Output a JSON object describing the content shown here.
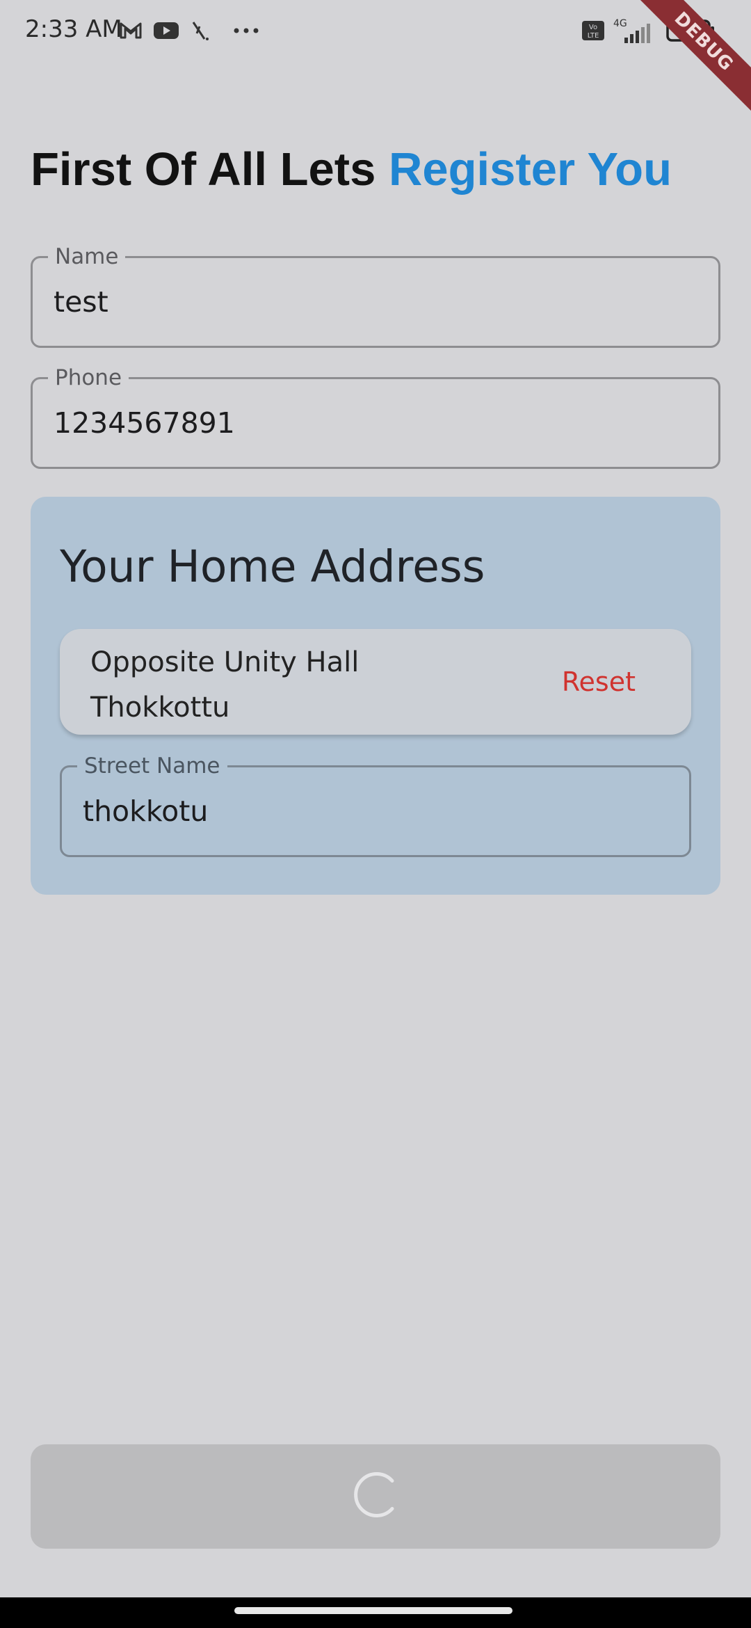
{
  "status_bar": {
    "time": "2:33 AM",
    "network": "4G",
    "volte": "Vo LTE",
    "icons": [
      "gmail-icon",
      "youtube-icon",
      "tool-icon",
      "more-dots-icon",
      "volte-icon",
      "signal-icon",
      "battery-icon"
    ]
  },
  "debug_banner": "DEBUG",
  "title": {
    "prefix": "First Of All Lets ",
    "accent": "Register You",
    "accent_color": "#1f85d2"
  },
  "form": {
    "name": {
      "label": "Name",
      "value": "test"
    },
    "phone": {
      "label": "Phone",
      "value": "1234567891"
    }
  },
  "address": {
    "title": "Your Home Address",
    "location_line1": "Opposite Unity Hall",
    "location_line2": "Thokkottu",
    "reset_label": "Reset",
    "reset_color": "#d0332f",
    "street": {
      "label": "Street Name",
      "value": "thokkotu"
    }
  },
  "submit": {
    "state": "loading",
    "icon": "spinner-icon"
  }
}
